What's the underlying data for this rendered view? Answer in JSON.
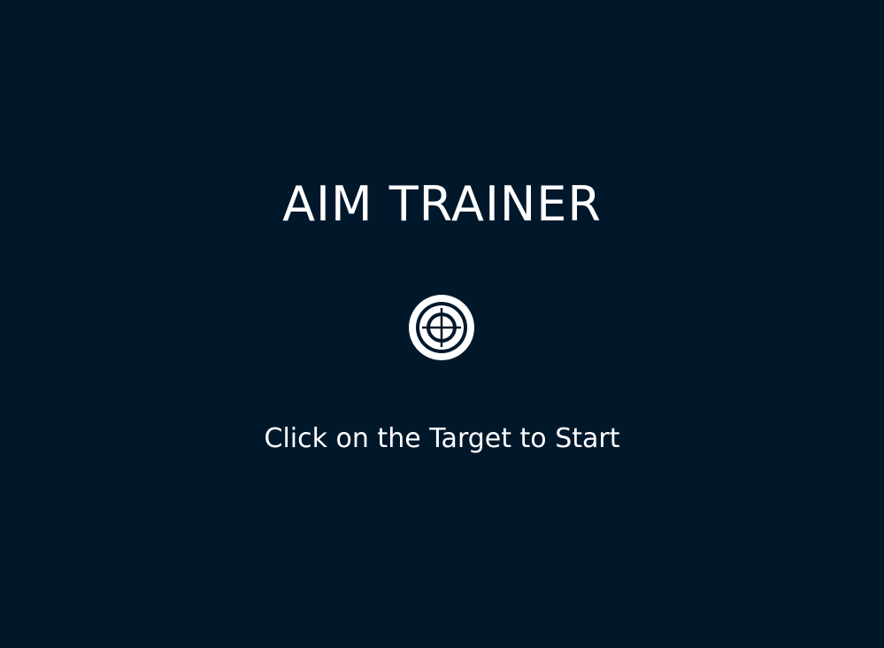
{
  "game": {
    "title": "AIM TRAINER",
    "instruction": "Click on the Target to Start",
    "start_target_icon": "crosshair-target-icon"
  },
  "colors": {
    "background": "#01182b",
    "foreground": "#ffffff"
  }
}
